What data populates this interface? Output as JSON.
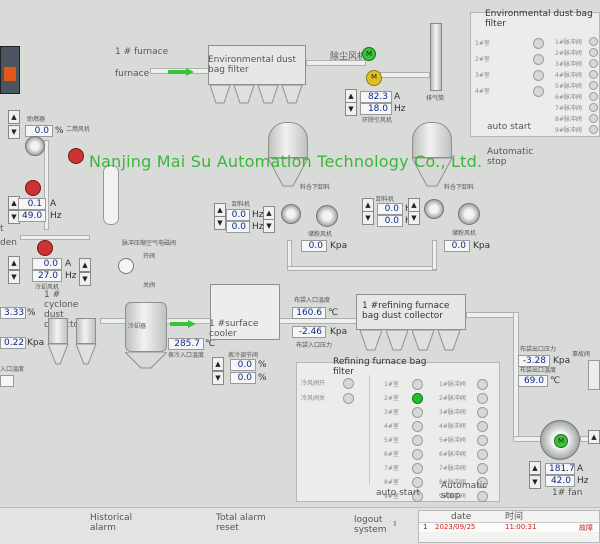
{
  "watermark": "Nanjing Mai Su Automation Technology Co., Ltd.",
  "top_left": {
    "furnace_label": "1 # furnace",
    "furnace_word": "furnace"
  },
  "env_filter": {
    "title": "Environmental dust bag filter"
  },
  "env_fan": {
    "label_cn": "除尘风机",
    "current": "82.3",
    "current_unit": "A",
    "freq": "18.0",
    "freq_unit": "Hz",
    "sub_label": "环除引风机"
  },
  "chimney": {
    "label": "排气筒"
  },
  "env_panel": {
    "title": "Environmental dust bag filter",
    "auto_start": "auto start",
    "auto_stop": "Automatic stop",
    "rooms": [
      "1#室",
      "2#室",
      "3#室",
      "4#室"
    ],
    "valves": [
      "1#脉冲阀",
      "2#脉冲阀",
      "3#脉冲阀",
      "4#脉冲阀",
      "5#脉冲阀",
      "6#脉冲阀",
      "7#脉冲阀",
      "8#脉冲阀",
      "9#脉冲阀"
    ]
  },
  "left_blower": {
    "label_cn": "助燃器",
    "value": "0.0",
    "unit": "%"
  },
  "left_secondary": {
    "label_cn": "二燃风机"
  },
  "left_fan": {
    "current": "0.1",
    "current_unit": "A",
    "freq": "49.0",
    "freq_unit": "Hz"
  },
  "left_mid": {
    "cut_text": "t",
    "den_text": "den",
    "current": "0.0",
    "current_unit": "A",
    "freq": "27.0",
    "freq_unit": "Hz",
    "sub_label": "冷却风机"
  },
  "left_bottom": {
    "pct": "3.33",
    "pct_unit": "%",
    "pressure": "0.22",
    "pressure_unit": "Kpa",
    "temp_label": "入口温度"
  },
  "cyclone": {
    "title": "1 # cyclone dust collector"
  },
  "pulse_air": {
    "label_cn": "脉冲压缩空气电磁阀",
    "open": "开阀",
    "close": "关阀"
  },
  "cooler_tank": {
    "label_cn": "冷却器"
  },
  "tank_temp": {
    "value": "285.7",
    "unit": "℃",
    "label_cn": "表冷入口温度"
  },
  "surface_cooler": {
    "title": "1 #surface cooler",
    "v1": "0.0",
    "v1_unit": "%",
    "v2": "0.0",
    "v2_unit": "%",
    "label_cn": "表冷调节阀"
  },
  "silo1": {
    "label_cn": "料仓下卸料",
    "feeder_label": "卸料机",
    "v1": "0.0",
    "v1_unit": "Hz",
    "v2": "0.0",
    "v2_unit": "Hz",
    "fan_label": "储粉风机",
    "kpa": "0.0",
    "kpa_unit": "Kpa"
  },
  "silo2": {
    "label_cn": "料仓下卸料",
    "feeder_label": "卸料机",
    "v1": "0.0",
    "v1_unit": "Hz",
    "v2": "0.0",
    "v2_unit": "Hz",
    "fan_label": "储粉风机",
    "kpa": "0.0",
    "kpa_unit": "Kpa"
  },
  "refining_filter": {
    "title": "1 #refining furnace bag dust collector",
    "inlet_label": "布袋入口温度",
    "inlet_temp": "160.6",
    "inlet_unit": "℃",
    "pressure": "-2.46",
    "pressure_unit": "Kpa",
    "pressure_label": "布袋入口压力"
  },
  "refining_panel": {
    "title": "Refining furnace bag filter",
    "cold_start": "冷风阀开",
    "cold_close": "冷风阀关",
    "rooms": [
      "1#室",
      "2#室",
      "3#室",
      "4#室",
      "5#室",
      "6#室",
      "7#室",
      "8#室",
      "9#室"
    ],
    "valves": [
      "1#脉冲阀",
      "2#脉冲阀",
      "3#脉冲阀",
      "4#脉冲阀",
      "5#脉冲阀",
      "6#脉冲阀",
      "7#脉冲阀",
      "8#脉冲阀",
      "9#脉冲阀"
    ],
    "auto_start": "auto start",
    "auto_stop": "Automatic stop"
  },
  "outlet": {
    "pressure": "-3.28",
    "pressure_unit": "Kpa",
    "pressure_label": "布袋出口压力",
    "temp": "69.0",
    "temp_unit": "℃",
    "temp_label": "布袋出口温度",
    "side_label": "事故阀"
  },
  "main_fan": {
    "current": "181.7",
    "current_unit": "A",
    "freq": "42.0",
    "freq_unit": "Hz",
    "label": "1# fan"
  },
  "footer": {
    "historical_alarm": "Historical alarm",
    "total_alarm_reset": "Total alarm reset",
    "logout": "logout system",
    "date_header": "date",
    "time_header": "时间",
    "row_index": "1",
    "row_date": "2023/09/25",
    "row_time": "11:00:31",
    "row_msg": "故障"
  },
  "colors": {
    "watermark": "#3bb53b",
    "active": "#1fbf2a",
    "value_text": "#0a2a8a"
  }
}
